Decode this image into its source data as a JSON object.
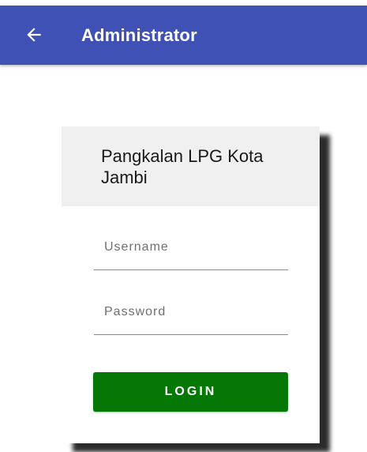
{
  "app_bar": {
    "title": "Administrator",
    "back_icon": "arrow-left-icon",
    "color": "#3f51b5"
  },
  "card": {
    "title": "Pangkalan LPG Kota Jambi",
    "header_color": "#f0f0f0"
  },
  "form": {
    "username_placeholder": "Username",
    "password_placeholder": "Password",
    "username_value": "",
    "password_value": "",
    "login_label": "LOGIN",
    "login_color": "#057705"
  }
}
